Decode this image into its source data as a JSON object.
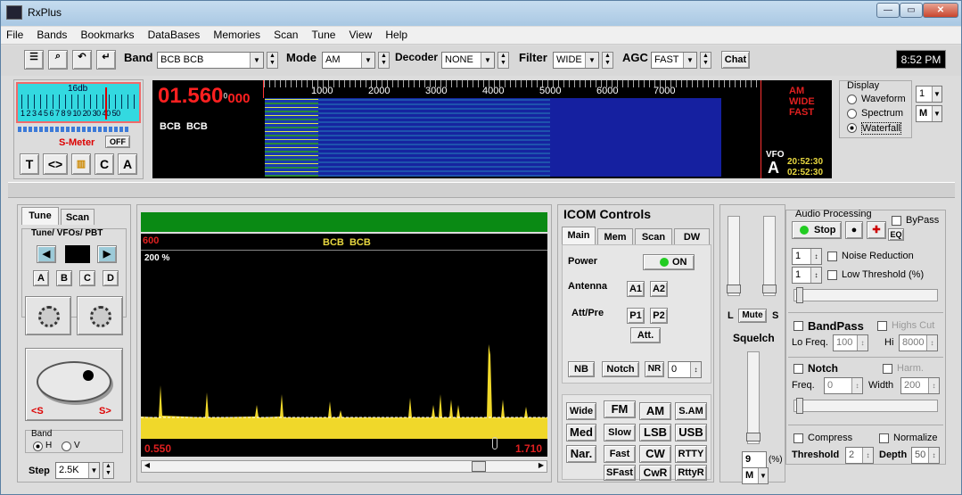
{
  "app": {
    "title": "RxPlus",
    "clock": "8:52 PM"
  },
  "menu": [
    "File",
    "Bands",
    "Bookmarks",
    "DataBases",
    "Memories",
    "Scan",
    "Tune",
    "View",
    "Help"
  ],
  "toolbar": {
    "band_label": "Band",
    "band_value": "BCB BCB",
    "mode_label": "Mode",
    "mode_value": "AM",
    "decoder_label": "Decoder",
    "decoder_value": "NONE",
    "filter_label": "Filter",
    "filter_value": "WIDE",
    "agc_label": "AGC",
    "agc_value": "FAST",
    "chat_label": "Chat"
  },
  "smeter": {
    "scale_top": "16db",
    "scale_nums": "1 2 3 4 5 6 7 8 9 10 20 30 40 50",
    "label": "S-Meter",
    "off": "OFF",
    "btns": [
      "T",
      "<>",
      "",
      "C",
      "A"
    ]
  },
  "display": {
    "freq_main": "01.560",
    "freq_sup": "0",
    "freq_sub": "000",
    "band": "BCB  BCB",
    "scale": [
      "1000",
      "2000",
      "3000",
      "4000",
      "5000",
      "6000",
      "7000"
    ],
    "mode": "AM",
    "width": "WIDE",
    "agc": "FAST",
    "vfo_label": "VFO",
    "vfo": "A",
    "time1": "20:52:30",
    "time2": "02:52:30"
  },
  "display_opts": {
    "title": "Display",
    "options": [
      "Waveform",
      "Spectrum",
      "Waterfall"
    ],
    "selected": "Waterfall",
    "spin1": "1",
    "spin2": "M"
  },
  "tune": {
    "tabs": [
      "Tune",
      "Scan"
    ],
    "group": "Tune/ VFOs/ PBT",
    "vfo_btns": [
      "A",
      "B",
      "C",
      "D"
    ],
    "s_left": "<S",
    "s_right": "S>",
    "band_label": "Band",
    "band_h": "H",
    "band_v": "V",
    "step_label": "Step",
    "step_value": "2.5K"
  },
  "spectrum": {
    "scale_top": "600",
    "band": "BCB  BCB",
    "zoom": "200 %",
    "freq_low": "0.550",
    "freq_high": "1.710"
  },
  "icom": {
    "title": "ICOM Controls",
    "tabs": [
      "Main",
      "Mem",
      "Scan",
      "DW"
    ],
    "power_label": "Power",
    "power_value": "ON",
    "antenna_label": "Antenna",
    "a1": "A1",
    "a2": "A2",
    "attpre_label": "Att/Pre",
    "p1": "P1",
    "p2": "P2",
    "att": "Att.",
    "nb": "NB",
    "notch": "Notch",
    "nr": "NR",
    "nr_value": "0",
    "filters": [
      "Wide",
      "Med",
      "Nar."
    ],
    "modes": [
      "FM",
      "AM",
      "S.AM",
      "Slow",
      "LSB",
      "USB",
      "Fast",
      "CW",
      "RTTY",
      "SFast",
      "CwR",
      "RttyR"
    ]
  },
  "squelch": {
    "l": "L",
    "mute": "Mute",
    "s": "S",
    "label": "Squelch",
    "value": "9",
    "unit": "(%)",
    "mode": "M"
  },
  "audio": {
    "title": "Audio Processing",
    "stop": "Stop",
    "bypass": "ByPass",
    "eq": "EQ",
    "spin1": "1",
    "spin2": "1",
    "noise_reduction": "Noise Reduction",
    "low_threshold": "Low Threshold (%)",
    "bandpass": "BandPass",
    "highs_cut": "Highs Cut",
    "lo_freq_label": "Lo Freq.",
    "lo_freq": "100",
    "hi_label": "Hi",
    "hi": "8000",
    "notch": "Notch",
    "harm": "Harm.",
    "freq_label": "Freq.",
    "freq": "0",
    "width_label": "Width",
    "width": "200",
    "compress": "Compress",
    "normalize": "Normalize",
    "threshold_label": "Threshold",
    "threshold": "2",
    "depth_label": "Depth",
    "depth": "50"
  }
}
